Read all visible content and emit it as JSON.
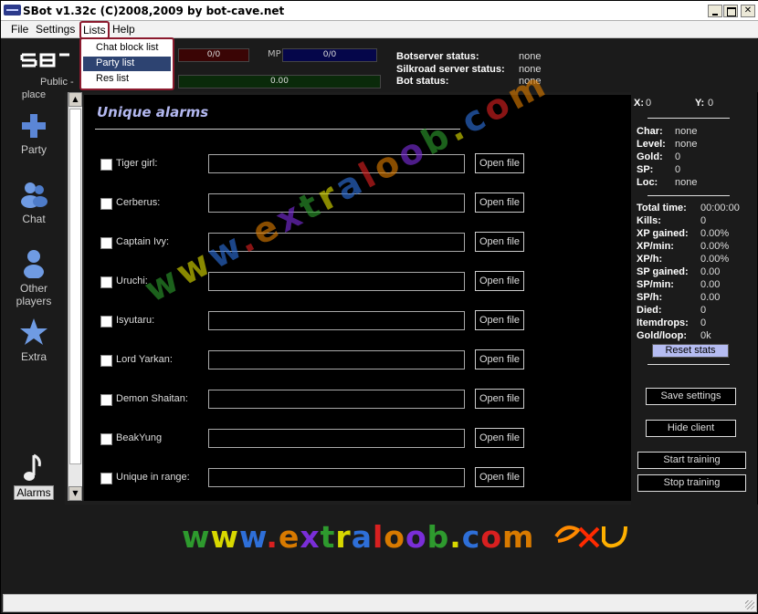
{
  "window": {
    "title": "SBot v1.32c (C)2008,2009 by bot-cave.net",
    "app_icon": "sbot-icon",
    "controls": [
      "minimize-icon",
      "maximize-icon",
      "close-icon"
    ]
  },
  "menubar": {
    "file": "File",
    "settings": "Settings",
    "lists": "Lists",
    "help": "Help"
  },
  "lists_menu": {
    "items": [
      "Chat block list",
      "Party list",
      "Res list"
    ],
    "selected": "Party list",
    "highlight_color": "#2d4371",
    "outline_color": "#8b1a2e"
  },
  "header": {
    "logo": "SBot",
    "public_label": "Public -",
    "hp_value": "0/0",
    "mp_label": "MP",
    "mp_value": "0/0",
    "xp_value": "0.00",
    "botserver_label": "Botserver status:",
    "botserver_value": "none",
    "silkroad_label": "Silkroad server status:",
    "silkroad_value": "none",
    "bot_label": "Bot status:",
    "bot_value": "none"
  },
  "sidebar": {
    "items": [
      {
        "label": "place",
        "icon": "home-icon"
      },
      {
        "label": "Party",
        "icon": "plus-icon"
      },
      {
        "label": "Chat",
        "icon": "chat-people-icon"
      },
      {
        "label": "Other players",
        "label1": "Other",
        "label2": "players",
        "icon": "person-icon"
      },
      {
        "label": "Extra",
        "icon": "star-icon"
      },
      {
        "label": "Alarms",
        "icon": "music-note-icon"
      }
    ]
  },
  "main": {
    "title": "Unique alarms",
    "open_label": "Open file",
    "alarms": [
      {
        "label": "Tiger girl:",
        "checked": false,
        "value": ""
      },
      {
        "label": "Cerberus:",
        "checked": false,
        "value": ""
      },
      {
        "label": "Captain Ivy:",
        "checked": false,
        "value": ""
      },
      {
        "label": "Uruchi:",
        "checked": false,
        "value": ""
      },
      {
        "label": "Isyutaru:",
        "checked": false,
        "value": ""
      },
      {
        "label": "Lord Yarkan:",
        "checked": false,
        "value": ""
      },
      {
        "label": "Demon Shaitan:",
        "checked": false,
        "value": ""
      },
      {
        "label": "BeakYung",
        "checked": false,
        "value": ""
      },
      {
        "label": "Unique in range:",
        "checked": false,
        "value": ""
      }
    ]
  },
  "right": {
    "x_label": "X:",
    "x_value": "0",
    "y_label": "Y:",
    "y_value": "0",
    "char_label": "Char:",
    "char_value": "none",
    "level_label": "Level:",
    "level_value": "none",
    "gold_label": "Gold:",
    "gold_value": "0",
    "sp_label": "SP:",
    "sp_value": "0",
    "loc_label": "Loc:",
    "loc_value": "none",
    "stats": [
      {
        "label": "Total time:",
        "value": "00:00:00"
      },
      {
        "label": "Kills:",
        "value": "0"
      },
      {
        "label": "XP gained:",
        "value": "0.00%"
      },
      {
        "label": "XP/min:",
        "value": "0.00%"
      },
      {
        "label": "XP/h:",
        "value": "0.00%"
      },
      {
        "label": "SP gained:",
        "value": "0.00"
      },
      {
        "label": "SP/min:",
        "value": "0.00"
      },
      {
        "label": "SP/h:",
        "value": "0.00"
      },
      {
        "label": "Died:",
        "value": "0"
      },
      {
        "label": "Itemdrops:",
        "value": "0"
      },
      {
        "label": "Gold/loop:",
        "value": "0k"
      }
    ],
    "reset_stats": "Reset stats",
    "save_settings": "Save settings",
    "hide_client": "Hide client",
    "start_training": "Start training",
    "stop_training": "Stop training"
  },
  "watermark": {
    "text": "www.extraloob.com",
    "logo_text": "eXU"
  }
}
